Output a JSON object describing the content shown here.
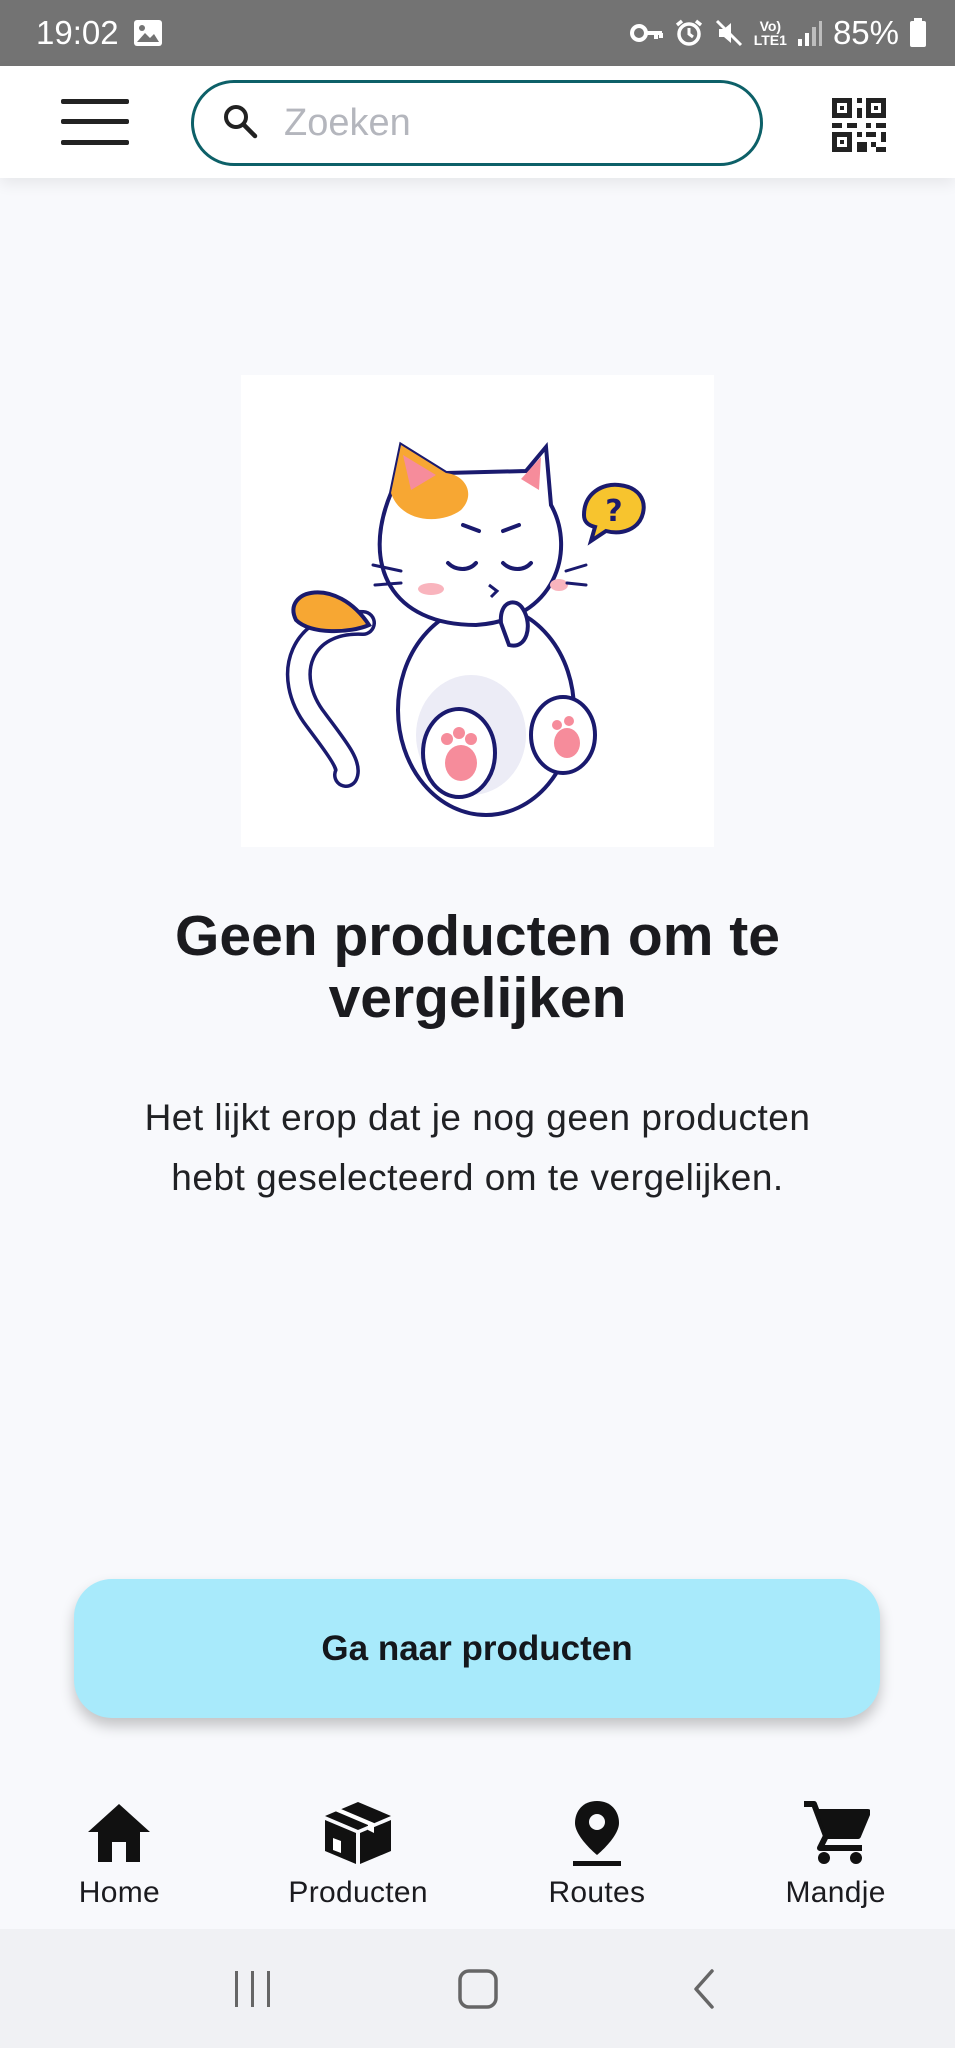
{
  "status_bar": {
    "time": "19:02",
    "battery_percent": "85%",
    "network_label_top": "Vo)",
    "network_label_bottom": "LTE1"
  },
  "app_bar": {
    "search_placeholder": "Zoeken",
    "search_value": ""
  },
  "empty_state": {
    "title": "Geen producten om te vergelijken",
    "description": "Het lijkt erop dat je nog geen producten hebt geselecteerd om te vergelijken.",
    "action_label": "Ga naar producten"
  },
  "bottom_nav": {
    "items": [
      {
        "label": "Home",
        "icon": "home-icon"
      },
      {
        "label": "Producten",
        "icon": "package-icon"
      },
      {
        "label": "Routes",
        "icon": "location-pin-icon"
      },
      {
        "label": "Mandje",
        "icon": "cart-icon"
      }
    ]
  },
  "colors": {
    "accent_border": "#0d6068",
    "button_bg": "#a8eafb",
    "status_bar_bg": "#737373",
    "page_bg": "#f8f9fc"
  }
}
